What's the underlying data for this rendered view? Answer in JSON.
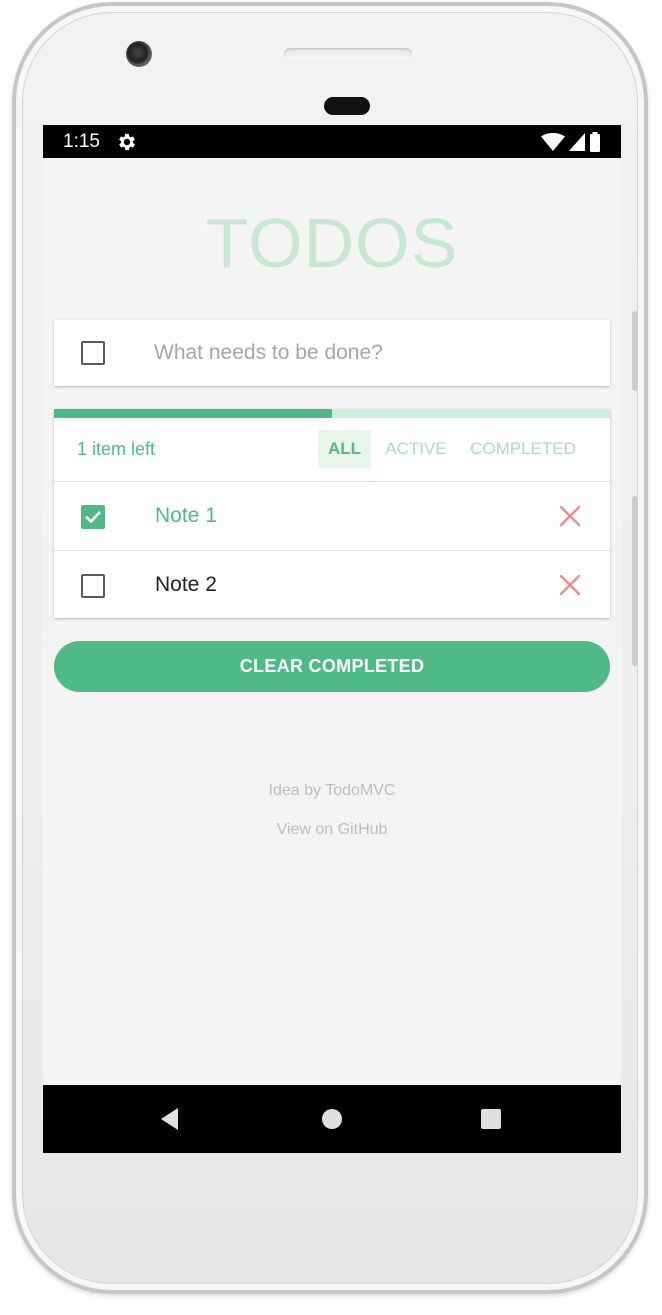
{
  "status_bar": {
    "time": "1:15",
    "icons": [
      "gear-icon",
      "wifi-icon",
      "cell-signal-icon",
      "battery-icon"
    ]
  },
  "app": {
    "title": "TODOS",
    "new_todo": {
      "value": "",
      "placeholder": "What needs to be done?"
    },
    "progress": {
      "completed_fraction": 0.5
    },
    "items_left_label": "1 item left",
    "filters": [
      {
        "label": "ALL",
        "selected": true
      },
      {
        "label": "ACTIVE",
        "selected": false
      },
      {
        "label": "COMPLETED",
        "selected": false
      }
    ],
    "todos": [
      {
        "text": "Note 1",
        "completed": true
      },
      {
        "text": "Note 2",
        "completed": false
      }
    ],
    "clear_completed_label": "CLEAR COMPLETED",
    "footer": {
      "idea_text": "Idea by TodoMVC",
      "github_text": "View on GitHub"
    }
  },
  "navigation_bar": {
    "buttons": [
      "back-icon",
      "home-icon",
      "recents-icon"
    ]
  },
  "colors": {
    "accent": "#4fba86",
    "accent_light": "#cdeedb",
    "title": "#c7e6d4",
    "delete": "#f08b8b",
    "background": "#f4f4f4"
  }
}
